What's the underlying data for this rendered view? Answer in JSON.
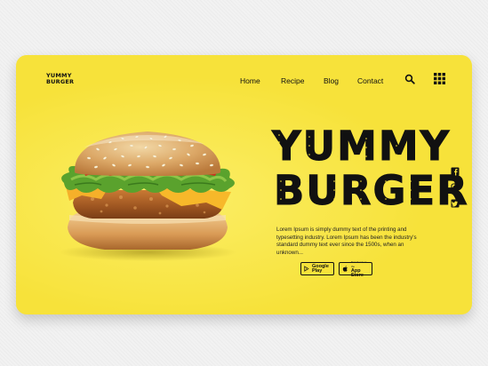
{
  "logo": {
    "line1": "YUMMY",
    "line2": "BURGER"
  },
  "nav": {
    "home": "Home",
    "recipe": "Recipe",
    "blog": "Blog",
    "contact": "Contact"
  },
  "hero": {
    "title_line1": "YUMMY",
    "title_line2": "BURGER",
    "description": "Lorem Ipsum is simply dummy text of the printing and typesetting industry. Lorem Ipsum has been the industry's standard dummy text ever since the 1500s, when an unknown..."
  },
  "stores": {
    "google_small": "",
    "google_big": "Google Play",
    "apple_small": "Download on the",
    "apple_big": "App Store"
  },
  "icons": {
    "search": "search-icon",
    "grid": "grid-menu-icon",
    "facebook": "facebook-icon",
    "instagram": "instagram-icon",
    "twitter": "twitter-icon",
    "play": "google-play-icon",
    "apple": "apple-icon"
  },
  "colors": {
    "accent": "#f7e23a",
    "text": "#111111"
  }
}
